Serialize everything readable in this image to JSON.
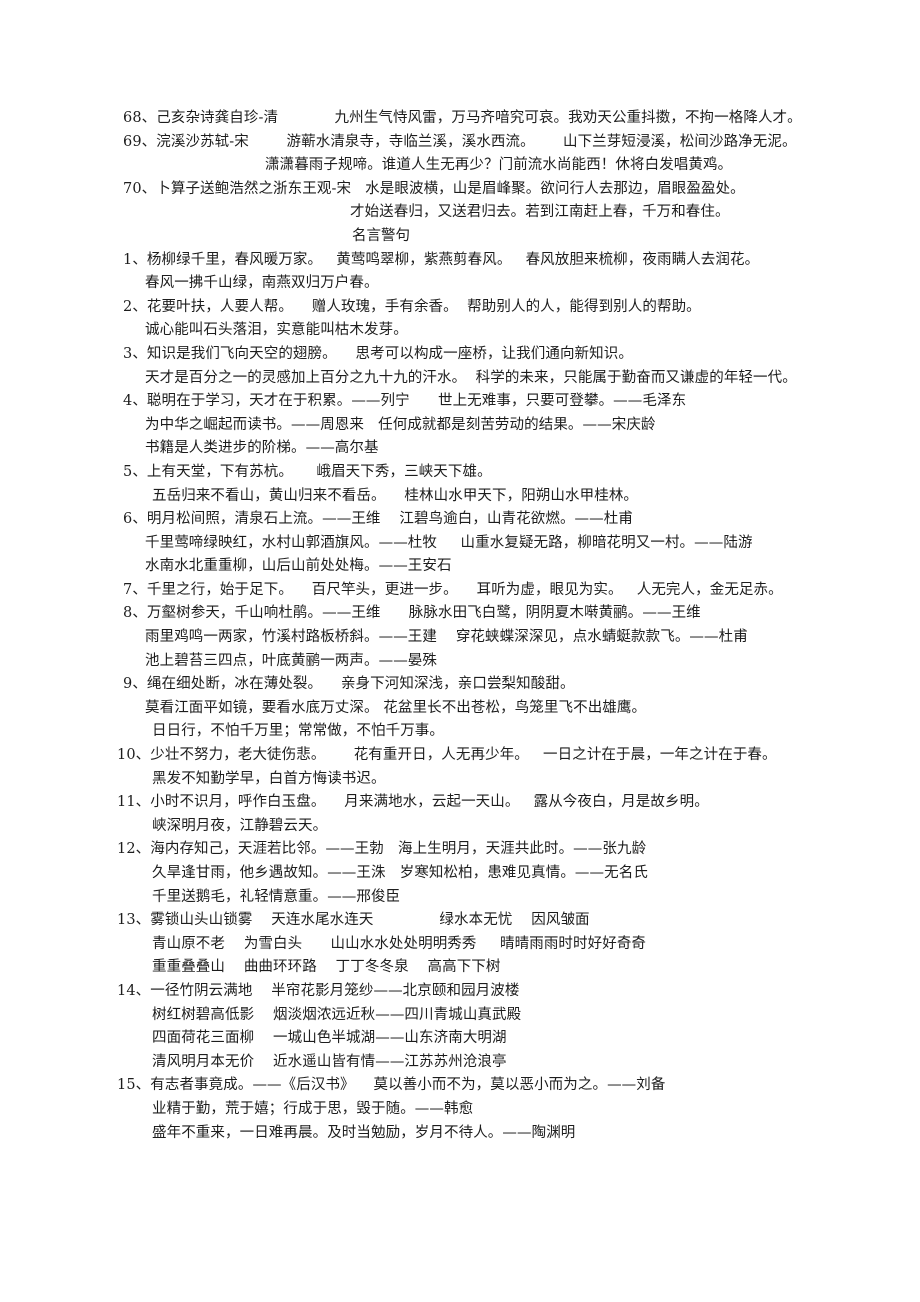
{
  "document": {
    "section_heading": "名言警句",
    "poem_block": [
      {
        "id": "item-68",
        "indent": "ind-num",
        "text": "68、己亥杂诗龚自珍-清            九州生气恃风雷，万马齐喑究可哀。我劝天公重抖擞，不拘一格降人才。"
      },
      {
        "id": "item-69",
        "indent": "ind-num",
        "text": "69、浣溪沙苏轼-宋        游蕲水清泉寺，寺临兰溪，溪水西流。      山下兰芽短浸溪，松间沙路净无泥。"
      },
      {
        "id": "item-69-line2",
        "indent": "ind-mid",
        "text": "潇潇暮雨子规啼。谁道人生无再少？门前流水尚能西！休将白发唱黄鸡。"
      },
      {
        "id": "item-70",
        "indent": "ind-num",
        "text": "70、卜算子送鲍浩然之浙东王观-宋   水是眼波横，山是眉峰聚。欲问行人去那边，眉眼盈盈处。"
      },
      {
        "id": "item-70-line2",
        "indent": "ind-mid2",
        "text": "才始送春归，又送君归去。若到江南赶上春，千万和春住。"
      }
    ],
    "quote_block": [
      {
        "id": "item-1",
        "indent": "ind-num",
        "text": "1、杨柳绿千里，春风暖万家。   黄莺鸣翠柳，紫燕剪春风。   春风放胆来梳柳，夜雨瞒人去润花。"
      },
      {
        "id": "item-1b",
        "indent": "ind-sub",
        "text": "春风一拂千山绿，南燕双归万户春。"
      },
      {
        "id": "item-2",
        "indent": "ind-num",
        "text": "2、花要叶扶，人要人帮。    赠人玫瑰，手有余香。  帮助别人的人，能得到别人的帮助。"
      },
      {
        "id": "item-2b",
        "indent": "ind-sub",
        "text": "诚心能叫石头落泪，实意能叫枯木发芽。"
      },
      {
        "id": "item-3",
        "indent": "ind-num",
        "text": "3、知识是我们飞向天空的翅膀。    思考可以构成一座桥，让我们通向新知识。"
      },
      {
        "id": "item-3b",
        "indent": "ind-sub",
        "text": "天才是百分之一的灵感加上百分之九十九的汗水。  科学的未来，只能属于勤奋而又谦虚的年轻一代。"
      },
      {
        "id": "item-4",
        "indent": "ind-num",
        "text": "4、聪明在于学习，天才在于积累。——列宁      世上无难事，只要可登攀。——毛泽东"
      },
      {
        "id": "item-4b",
        "indent": "ind-sub",
        "text": "为中华之崛起而读书。——周恩来   任何成就都是刻苦劳动的结果。——宋庆龄"
      },
      {
        "id": "item-4c",
        "indent": "ind-sub",
        "text": "书籍是人类进步的阶梯。——高尔基"
      },
      {
        "id": "item-5",
        "indent": "ind-num",
        "text": "5、上有天堂，下有苏杭。     峨眉天下秀，三峡天下雄。"
      },
      {
        "id": "item-5b",
        "indent": "ind-sub2",
        "text": "五岳归来不看山，黄山归来不看岳。    桂林山水甲天下，阳朔山水甲桂林。"
      },
      {
        "id": "item-6",
        "indent": "ind-num",
        "text": "6、明月松间照，清泉石上流。——王维    江碧鸟逾白，山青花欲燃。——杜甫"
      },
      {
        "id": "item-6b",
        "indent": "ind-sub",
        "text": "千里莺啼绿映红，水村山郭酒旗风。——杜牧     山重水复疑无路，柳暗花明又一村。——陆游"
      },
      {
        "id": "item-6c",
        "indent": "ind-sub",
        "text": "水南水北重重柳，山后山前处处梅。——王安石"
      },
      {
        "id": "item-7",
        "indent": "ind-num",
        "text": "7、千里之行，始于足下。    百尺竿头，更进一步。    耳听为虚，眼见为实。   人无完人，金无足赤。"
      },
      {
        "id": "item-8",
        "indent": "ind-num",
        "text": "8、万壑树参天，千山响杜鹃。——王维      脉脉水田飞白鹭，阴阴夏木啭黄鹂。——王维"
      },
      {
        "id": "item-8b",
        "indent": "ind-sub",
        "text": "雨里鸡鸣一两家，竹溪村路板桥斜。——王建    穿花蛱蝶深深见，点水蜻蜓款款飞。——杜甫"
      },
      {
        "id": "item-8c",
        "indent": "ind-sub",
        "text": "池上碧苔三四点，叶底黄鹂一两声。——晏殊"
      },
      {
        "id": "item-9",
        "indent": "ind-num",
        "text": "9、绳在细处断，冰在薄处裂。    亲身下河知深浅，亲口尝梨知酸甜。"
      },
      {
        "id": "item-9b",
        "indent": "ind-sub",
        "text": "莫看江面平如镜，要看水底万丈深。 花盆里长不出苍松，鸟笼里飞不出雄鹰。"
      },
      {
        "id": "item-9c",
        "indent": "ind-sub2",
        "text": "日日行，不怕千万里；常常做，不怕千万事。"
      },
      {
        "id": "item-10",
        "indent": "ind-num2",
        "text": "10、少壮不努力，老大徒伤悲。      花有重开日，人无再少年。   一日之计在于晨，一年之计在于春。"
      },
      {
        "id": "item-10b",
        "indent": "ind-sub2",
        "text": "黑发不知勤学早，白首方悔读书迟。"
      },
      {
        "id": "item-11",
        "indent": "ind-num2",
        "text": "11、小时不识月，呼作白玉盘。    月来满地水，云起一天山。   露从今夜白，月是故乡明。"
      },
      {
        "id": "item-11b",
        "indent": "ind-sub2",
        "text": "峡深明月夜，江静碧云天。"
      },
      {
        "id": "item-12",
        "indent": "ind-num2",
        "text": "12、海内存知己，天涯若比邻。——王勃   海上生明月，天涯共此时。——张九龄"
      },
      {
        "id": "item-12b",
        "indent": "ind-sub2",
        "text": "久旱逢甘雨，他乡遇故知。——王洙   岁寒知松柏，患难见真情。——无名氏"
      },
      {
        "id": "item-12c",
        "indent": "ind-sub2",
        "text": "千里送鹅毛，礼轻情意重。——邢俊臣"
      },
      {
        "id": "item-13",
        "indent": "ind-num2",
        "text": "13、雾锁山头山锁雾    天连水尾水连天              绿水本无忧    因风皱面"
      },
      {
        "id": "item-13b",
        "indent": "ind-sub2",
        "text": "青山原不老    为雪白头      山山水水处处明明秀秀     晴晴雨雨时时好好奇奇"
      },
      {
        "id": "item-13c",
        "indent": "ind-sub2",
        "text": "重重叠叠山    曲曲环环路    丁丁冬冬泉    高高下下树"
      },
      {
        "id": "item-14",
        "indent": "ind-num2",
        "text": "14、一径竹阴云满地    半帘花影月笼纱——北京颐和园月波楼"
      },
      {
        "id": "item-14b",
        "indent": "ind-sub2",
        "text": "树红树碧高低影    烟淡烟浓远近秋——四川青城山真武殿"
      },
      {
        "id": "item-14c",
        "indent": "ind-sub2",
        "text": "四面荷花三面柳    一城山色半城湖——山东济南大明湖"
      },
      {
        "id": "item-14d",
        "indent": "ind-sub2",
        "text": "清风明月本无价    近水遥山皆有情——江苏苏州沧浪亭"
      },
      {
        "id": "item-15",
        "indent": "ind-num2",
        "text": "15、有志者事竟成。——《后汉书》    莫以善小而不为，莫以恶小而为之。——刘备"
      },
      {
        "id": "item-15b",
        "indent": "ind-sub2",
        "text": "业精于勤，荒于嬉；行成于思，毁于随。——韩愈"
      },
      {
        "id": "item-15c",
        "indent": "ind-sub2",
        "text": "盛年不重来，一日难再晨。及时当勉励，岁月不待人。——陶渊明"
      }
    ]
  },
  "colors": {
    "page_background": "#ffffff",
    "text": "#1d1d1d"
  }
}
